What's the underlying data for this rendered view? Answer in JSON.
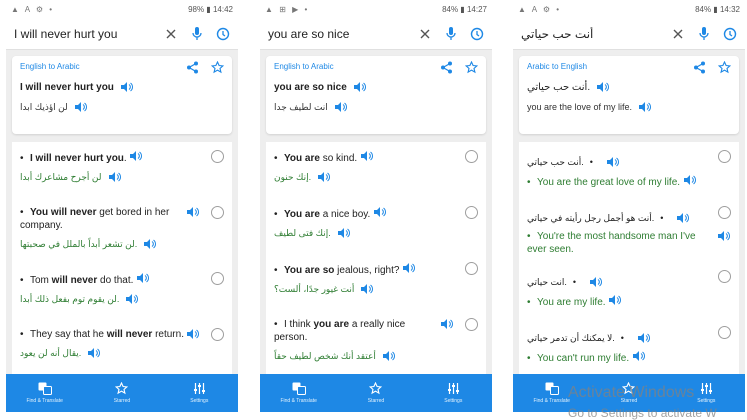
{
  "colors": {
    "accent": "#1e88e5",
    "green_text": "#2e7d32",
    "background": "#eeeeee"
  },
  "phones": [
    {
      "status": {
        "left": "▲ A ⚙ •",
        "right": "98% ▮ 14:42"
      },
      "query": "I will never hurt you",
      "card": {
        "direction": "English to Arabic",
        "source": "I will never hurt you",
        "target": "لن اؤذيك ابدا"
      },
      "nav": [
        "Find & Translate",
        "Starred",
        "Settings"
      ]
    },
    {
      "status": {
        "left": "▲ ⊞ ▶ •",
        "right": "84% ▮ 14:27"
      },
      "query": "you are so nice",
      "card": {
        "direction": "English to Arabic",
        "source": "you are so nice",
        "target": "انت لطيف جدا"
      },
      "nav": [
        "Find & Translate",
        "Starred",
        "Settings"
      ]
    },
    {
      "status": {
        "left": "▲ A ⚙ •",
        "right": "84% ▮ 14:32"
      },
      "query": "أنت حب حياتي",
      "card": {
        "direction": "Arabic to English",
        "source": "أنت حب حياتي.",
        "target": "you are the love of my life."
      },
      "nav": [
        "Find & Translate",
        "Starred",
        "Settings"
      ]
    }
  ],
  "items": {
    "p1": [
      {
        "parts": [
          "",
          "I will never hurt you",
          "."
        ],
        "ar": "لن أجرح مشاعرك أبدا"
      },
      {
        "parts": [
          "",
          "You will never",
          " get bored in her company."
        ],
        "ar": "لن تشعر أبداً بالملل في صحبتها."
      },
      {
        "parts": [
          "Tom ",
          "will never",
          " do that."
        ],
        "ar": "لن يقوم توم بفعل ذلك أبدا."
      },
      {
        "parts": [
          "They say that he ",
          "will never",
          " return."
        ],
        "ar": "يقال أنه لن يعود."
      }
    ],
    "p2": [
      {
        "parts": [
          "",
          "You are",
          " so kind."
        ],
        "ar": "إنك حنون."
      },
      {
        "parts": [
          "",
          "You are",
          " a nice boy."
        ],
        "ar": "إنك فتى لطيف."
      },
      {
        "parts": [
          "",
          "You are so",
          " jealous, right?"
        ],
        "ar": "أنت غيور جدًا، ألست؟"
      },
      {
        "parts": [
          "I think ",
          "you are",
          " a really nice person."
        ],
        "ar": "أعتقد أنك شخص لطيف حقاً"
      }
    ],
    "p3": [
      {
        "ar": "أنت حب حياتي.",
        "en": "You are the great love of my life."
      },
      {
        "ar": "أنت هو أجمل رجل رأيته في حياتي.",
        "en": "You're the most handsome man I've ever seen."
      },
      {
        "ar": "انت حياتي.",
        "en": "You are my life."
      },
      {
        "ar": "لا يمكنك أن تدمر حياتي.",
        "en": "You can't run my life."
      }
    ]
  },
  "watermark": {
    "line1": "Activate Windows",
    "line2": "Go to Settings to activate W"
  }
}
